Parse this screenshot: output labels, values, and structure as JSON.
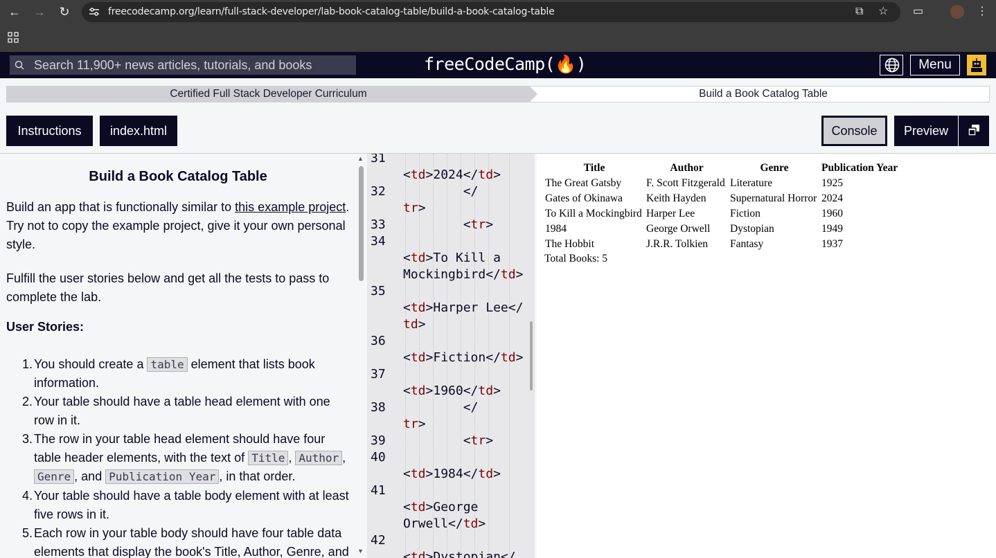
{
  "browser": {
    "url": "freecodecamp.org/learn/full-stack-developer/lab-book-catalog-table/build-a-book-catalog-table"
  },
  "header": {
    "search_placeholder": "Search 11,900+ news articles, tutorials, and books",
    "logo": "freeCodeCamp(🔥)",
    "menu_label": "Menu"
  },
  "breadcrumb": {
    "curriculum": "Certified Full Stack Developer Curriculum",
    "lesson": "Build a Book Catalog Table"
  },
  "tabs": {
    "instructions": "Instructions",
    "file": "index.html",
    "console": "Console",
    "preview": "Preview"
  },
  "instructions": {
    "title": "Build a Book Catalog Table",
    "intro_pre": "Build an app that is functionally similar to ",
    "intro_link": "this example project",
    "intro_post": ". Try not to copy the example project, give it your own personal style.",
    "fulfill": "Fulfill the user stories below and get all the tests to pass to complete the lab.",
    "stories_heading": "User Stories:",
    "s1_pre": "You should create a ",
    "s1_code": "table",
    "s1_post": " element that lists book information.",
    "s2": "Your table should have a table head element with one row in it.",
    "s3_pre": "The row in your table head element should have four table header elements, with the text of ",
    "s3_c1": "Title",
    "s3_c2": "Author",
    "s3_c3": "Genre",
    "s3_mid": ", and ",
    "s3_c4": "Publication Year",
    "s3_post": ", in that order.",
    "s4": "Your table should have a table body element with at least five rows in it.",
    "s5": "Each row in your table body should have four table data elements that display the book's Title, Author, Genre, and"
  },
  "editor": {
    "lines": [
      {
        "n": "31",
        "code": ""
      },
      {
        "n": "",
        "code": "<td>2024</td>"
      },
      {
        "n": "32",
        "code": "        </"
      },
      {
        "n": "",
        "code": "tr>"
      },
      {
        "n": "33",
        "code": "        <tr>"
      },
      {
        "n": "34",
        "code": ""
      },
      {
        "n": "",
        "code": "<td>To Kill a"
      },
      {
        "n": "",
        "code": "Mockingbird</td>"
      },
      {
        "n": "35",
        "code": ""
      },
      {
        "n": "",
        "code": "<td>Harper Lee</"
      },
      {
        "n": "",
        "code": "td>"
      },
      {
        "n": "36",
        "code": ""
      },
      {
        "n": "",
        "code": "<td>Fiction</td>"
      },
      {
        "n": "37",
        "code": ""
      },
      {
        "n": "",
        "code": "<td>1960</td>"
      },
      {
        "n": "38",
        "code": "        </"
      },
      {
        "n": "",
        "code": "tr>"
      },
      {
        "n": "39",
        "code": "        <tr>"
      },
      {
        "n": "40",
        "code": ""
      },
      {
        "n": "",
        "code": "<td>1984</td>"
      },
      {
        "n": "41",
        "code": ""
      },
      {
        "n": "",
        "code": "<td>George"
      },
      {
        "n": "",
        "code": "Orwell</td>"
      },
      {
        "n": "42",
        "code": ""
      },
      {
        "n": "",
        "code": "<td>Dystopian</"
      }
    ]
  },
  "preview": {
    "headers": [
      "Title",
      "Author",
      "Genre",
      "Publication Year"
    ],
    "rows": [
      [
        "The Great Gatsby",
        "F. Scott Fitzgerald",
        "Literature",
        "1925"
      ],
      [
        "Gates of Okinawa",
        "Keith Hayden",
        "Supernatural Horror",
        "2024"
      ],
      [
        "To Kill a Mockingbird",
        "Harper Lee",
        "Fiction",
        "1960"
      ],
      [
        "1984",
        "George Orwell",
        "Dystopian",
        "1949"
      ],
      [
        "The Hobbit",
        "J.R.R. Tolkien",
        "Fantasy",
        "1937"
      ]
    ],
    "total": "Total Books: 5"
  },
  "colors": {
    "fcc_dark": "#0a0a23",
    "tag": "#800000"
  }
}
